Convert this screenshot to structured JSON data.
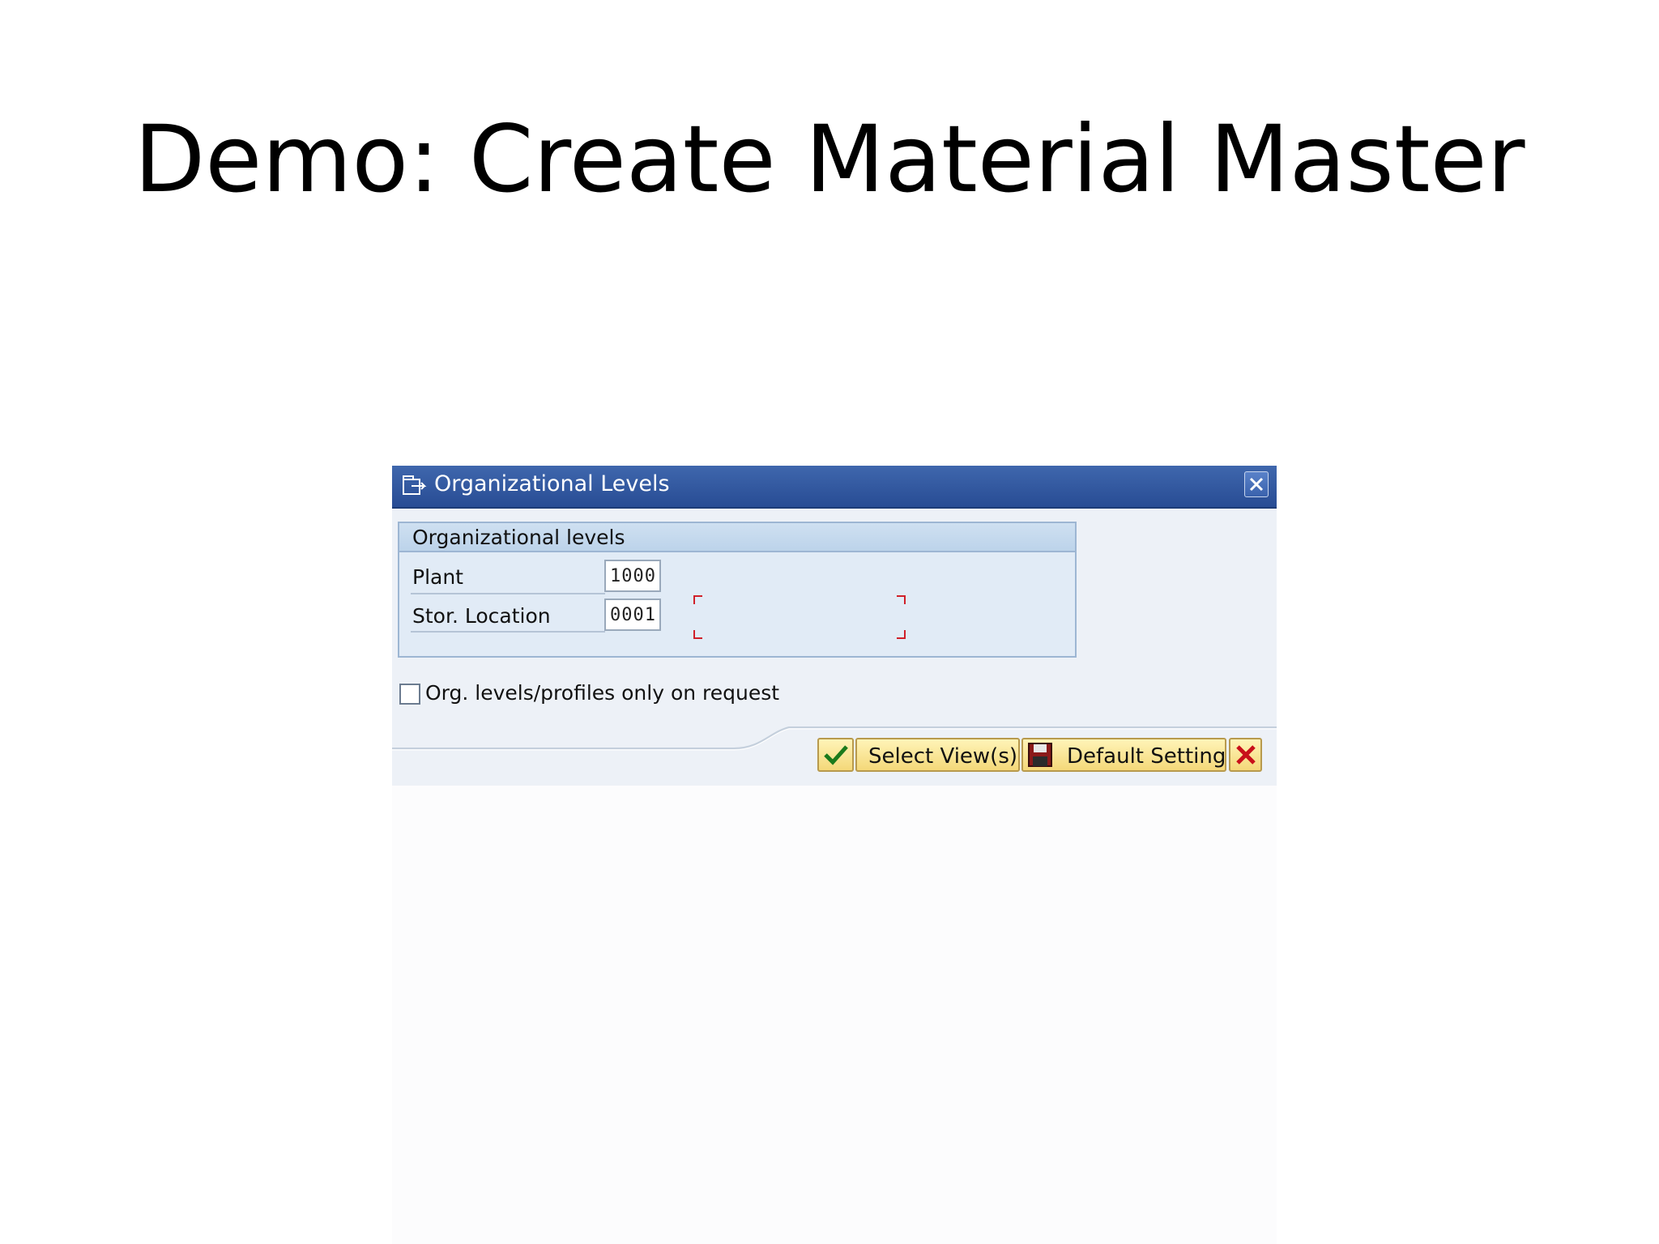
{
  "slide": {
    "title": "Demo: Create Material Master"
  },
  "dialog": {
    "title": "Organizational Levels",
    "group": {
      "title": "Organizational levels",
      "fields": [
        {
          "label": "Plant",
          "value": "1000"
        },
        {
          "label": "Stor. Location",
          "value": "0001"
        }
      ]
    },
    "checkbox": {
      "label": "Org. levels/profiles only on request",
      "checked": false
    },
    "buttons": {
      "confirm_icon": "checkmark-icon",
      "select_views_label": "Select View(s)",
      "default_setting_label": "Default Setting",
      "cancel_icon": "cancel-x-icon"
    }
  },
  "colors": {
    "titlebar": "#284c94",
    "dialog_bg": "#edf1f7",
    "group_bg": "#e1ebf6",
    "button_bg": "#f4d879",
    "focus_mark": "#d0202a"
  }
}
